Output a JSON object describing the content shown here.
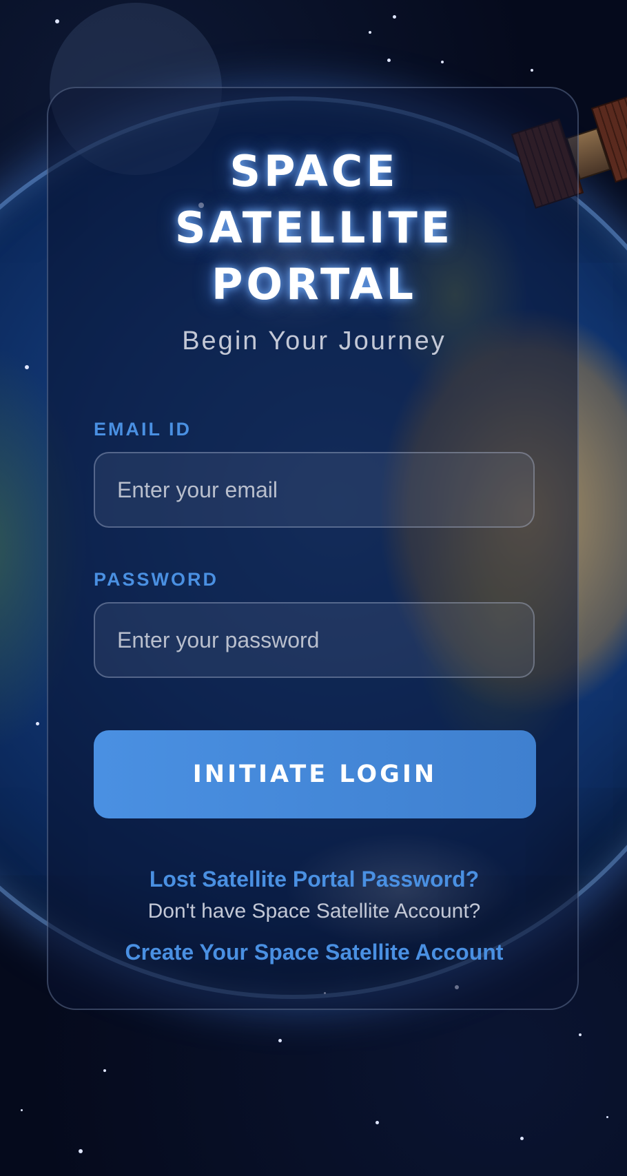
{
  "header": {
    "title_lines": [
      "SPACE",
      "SATELLITE",
      "PORTAL"
    ],
    "subtitle": "Begin Your Journey"
  },
  "form": {
    "email": {
      "label": "EMAIL ID",
      "placeholder": "Enter your email",
      "value": ""
    },
    "password": {
      "label": "PASSWORD",
      "placeholder": "Enter your password",
      "value": ""
    },
    "submit_label": "INITIATE LOGIN"
  },
  "links": {
    "forgot_password": "Lost Satellite Portal Password?",
    "no_account_text": "Don't have Space Satellite Account?",
    "create_account": "Create Your Space Satellite Account"
  },
  "colors": {
    "accent": "#4a90e2",
    "background": "#050a1c",
    "text_primary": "#ffffff",
    "text_muted": "#c3c8d6"
  },
  "background": {
    "earth": "earth-image",
    "satellite": "satellite-image"
  }
}
